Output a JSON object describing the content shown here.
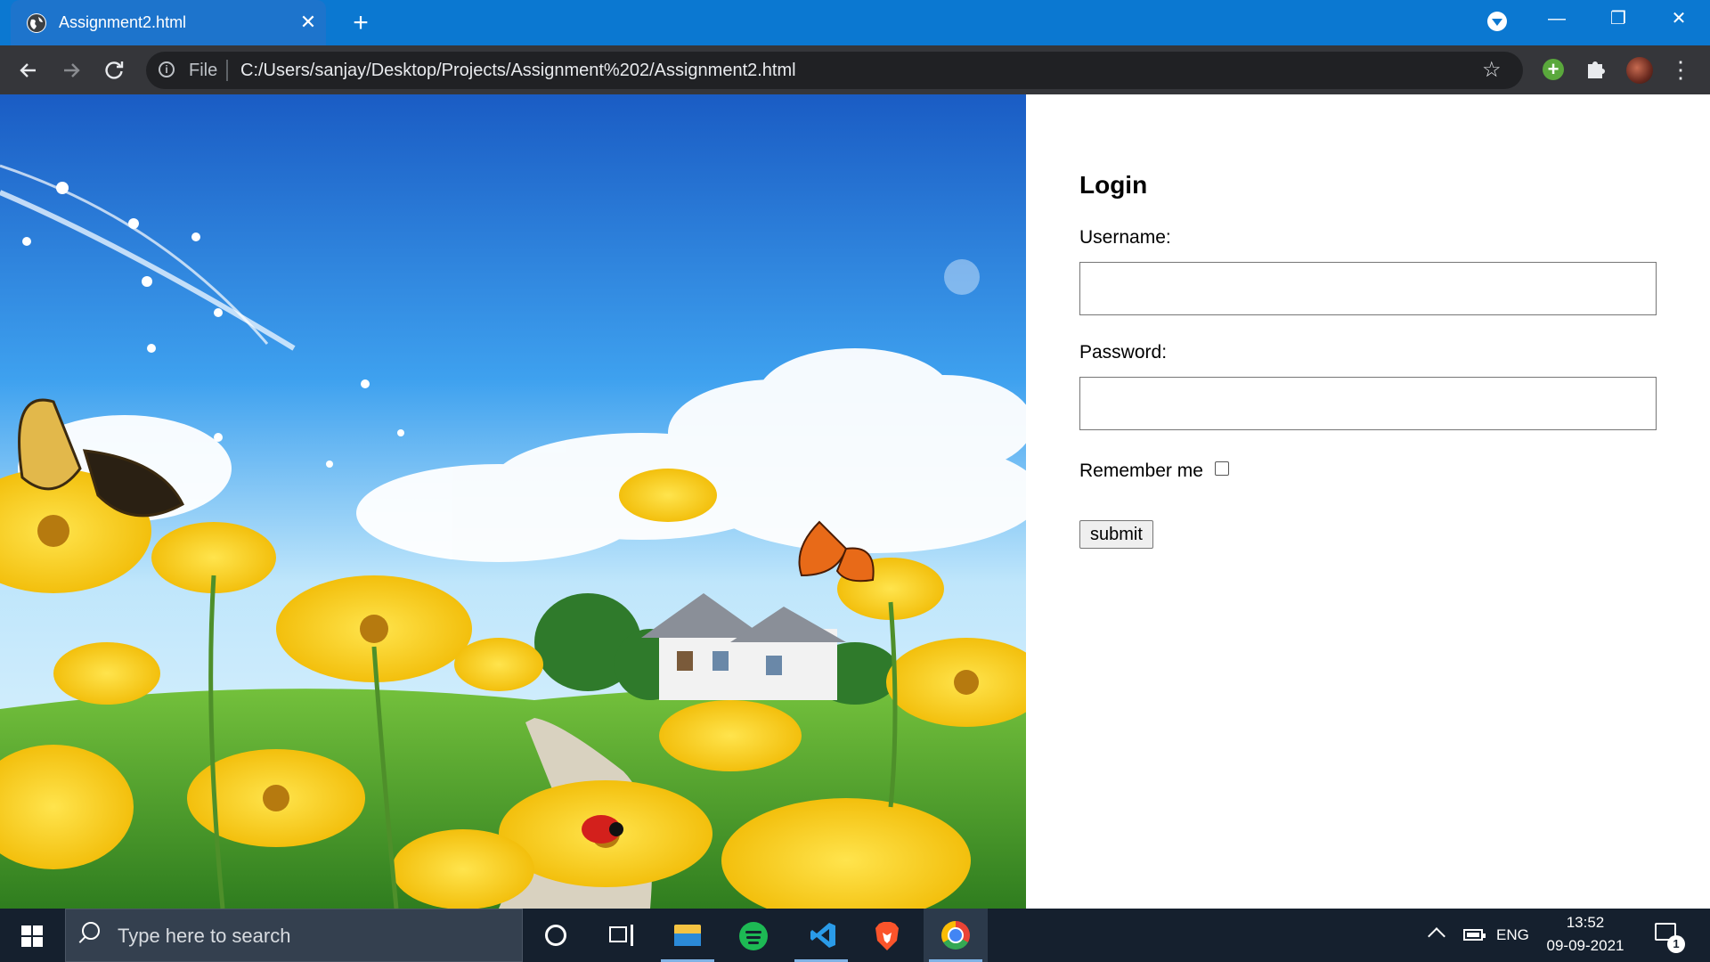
{
  "browser": {
    "tab_title": "Assignment2.html",
    "close_glyph": "✕",
    "new_tab_glyph": "+",
    "omnibox_scheme": "File",
    "url": "C:/Users/sanjay/Desktop/Projects/Assignment%202/Assignment2.html",
    "window_controls": {
      "minimize": "—",
      "maximize": "❐",
      "close": "✕"
    },
    "icons": [
      "globe-icon",
      "back-icon",
      "forward-icon",
      "reload-icon",
      "info-icon",
      "star-icon",
      "extension-add-icon",
      "puzzle-icon",
      "avatar",
      "menu-icon"
    ],
    "colors": {
      "tab_strip": "#0b78d1",
      "toolbar": "#35363a",
      "omnibox": "#202124"
    }
  },
  "login": {
    "title": "Login",
    "username_label": "Username:",
    "username_value": "",
    "password_label": "Password:",
    "password_value": "",
    "remember_label": "Remember me",
    "remember_checked": false,
    "submit_label": "submit"
  },
  "taskbar": {
    "search_placeholder": "Type here to search",
    "apps": [
      "cortana",
      "task-view",
      "file-explorer",
      "spotify",
      "vscode",
      "brave",
      "chrome"
    ],
    "active_app": "chrome",
    "tray": {
      "language": "ENG",
      "time": "13:52",
      "date": "09-09-2021",
      "notification_count": "1"
    },
    "colors": {
      "background": "#15202e",
      "search_box": "#34404f"
    }
  }
}
